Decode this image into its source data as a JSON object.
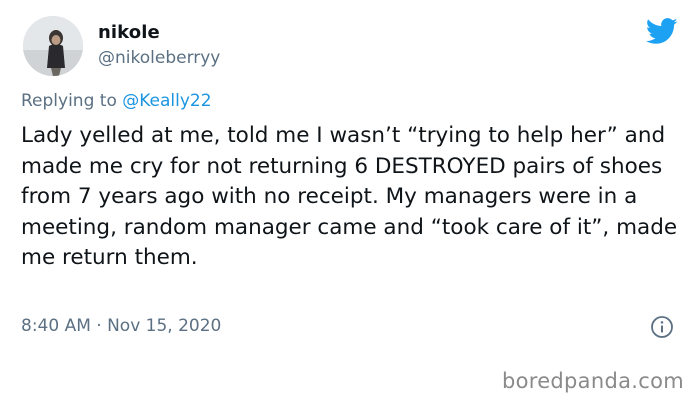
{
  "tweet": {
    "display_name": "nikole",
    "handle": "@nikoleberryy",
    "replying_to_prefix": "Replying to ",
    "replying_to_mention": "@Keally22",
    "text": "Lady yelled at me, told me I wasn’t “trying to help her” and made me cry for not returning 6 DESTROYED pairs of shoes from 7 years ago with no receipt. My managers were in a meeting, random manager came and “took care of it”, made me return them.",
    "timestamp": "8:40 AM · Nov 15, 2020"
  },
  "icons": {
    "brand": "twitter-bird-icon",
    "info": "info-icon"
  },
  "colors": {
    "twitter_blue": "#1da1f2",
    "mention_blue": "#1b95e0",
    "secondary_text": "#5b7083"
  },
  "watermark": "boredpanda.com"
}
